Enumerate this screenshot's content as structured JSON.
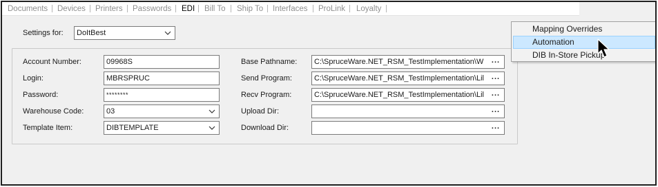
{
  "tabs": [
    {
      "label": "Documents",
      "active": false
    },
    {
      "label": "Devices",
      "active": false
    },
    {
      "label": "Printers",
      "active": false
    },
    {
      "label": "Passwords",
      "active": false
    },
    {
      "label": "EDI",
      "active": true
    },
    {
      "label": "Bill To",
      "active": false
    },
    {
      "label": "Ship To",
      "active": false
    },
    {
      "label": "Interfaces",
      "active": false
    },
    {
      "label": "ProLink",
      "active": false
    },
    {
      "label": "Loyalty",
      "active": false
    }
  ],
  "settings_for": {
    "label": "Settings for:",
    "value": "DoItBest"
  },
  "left_fields": {
    "account_number": {
      "label": "Account Number:",
      "value": "09968S"
    },
    "login": {
      "label": "Login:",
      "value": "MBRSPRUC"
    },
    "password": {
      "label": "Password:",
      "value": "********"
    },
    "warehouse_code": {
      "label": "Warehouse Code:",
      "value": "03"
    },
    "template_item": {
      "label": "Template Item:",
      "value": "DIBTEMPLATE"
    }
  },
  "right_fields": {
    "base_pathname": {
      "label": "Base Pathname:",
      "value": "C:\\SpruceWare.NET_RSM_TestImplementation\\W"
    },
    "send_program": {
      "label": "Send Program:",
      "value": "C:\\SpruceWare.NET_RSM_TestImplementation\\Lil"
    },
    "recv_program": {
      "label": "Recv Program:",
      "value": "C:\\SpruceWare.NET_RSM_TestImplementation\\Lil"
    },
    "upload_dir": {
      "label": "Upload Dir:",
      "value": ""
    },
    "download_dir": {
      "label": "Download Dir:",
      "value": ""
    }
  },
  "browse_label": "...",
  "context_menu": {
    "items": [
      {
        "label": "Mapping Overrides",
        "highlighted": false
      },
      {
        "label": "Automation",
        "highlighted": true
      },
      {
        "label": "DIB In-Store Pickup",
        "highlighted": false
      }
    ]
  },
  "colors": {
    "panel_bg": "#f0f0f0",
    "menu_highlight": "#cce8ff",
    "menu_highlight_border": "#99d1ff",
    "inactive_tab_text": "#8f8f8f"
  }
}
